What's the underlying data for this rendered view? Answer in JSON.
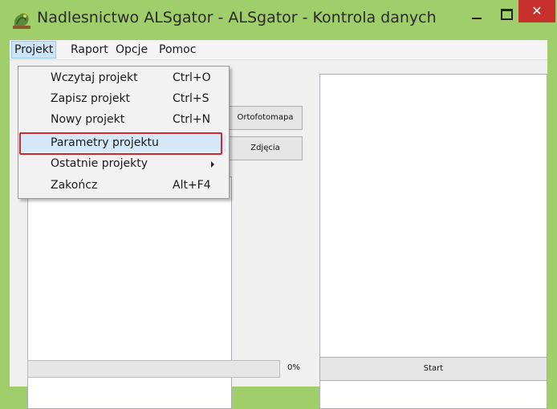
{
  "window": {
    "title": "Nadlesnictwo ALSgator - ALSgator - Kontrola danych",
    "minimize_label": "",
    "close_label": "✕"
  },
  "menubar": {
    "items": [
      "Projekt",
      "Raport",
      "Opcje",
      "Pomoc"
    ]
  },
  "projekt_menu": {
    "items": [
      {
        "label": "Wczytaj projekt",
        "shortcut": "Ctrl+O"
      },
      {
        "label": "Zapisz projekt",
        "shortcut": "Ctrl+S"
      },
      {
        "label": "Nowy projekt",
        "shortcut": "Ctrl+N"
      },
      {
        "label": "Parametry projektu",
        "shortcut": ""
      },
      {
        "label": "Ostatnie projekty",
        "shortcut": ""
      },
      {
        "label": "Zakończ",
        "shortcut": "Alt+F4"
      }
    ]
  },
  "main": {
    "ortofotomapa_label": "Ortofotomapa",
    "zdjecia_label": "Zdjęcia",
    "progress_value": 0,
    "progress_text": "0%",
    "start_label": "Start"
  },
  "colors": {
    "title_bg": "#9fce6a",
    "close_bg": "#c7302c",
    "highlight_border": "#d6242c"
  }
}
